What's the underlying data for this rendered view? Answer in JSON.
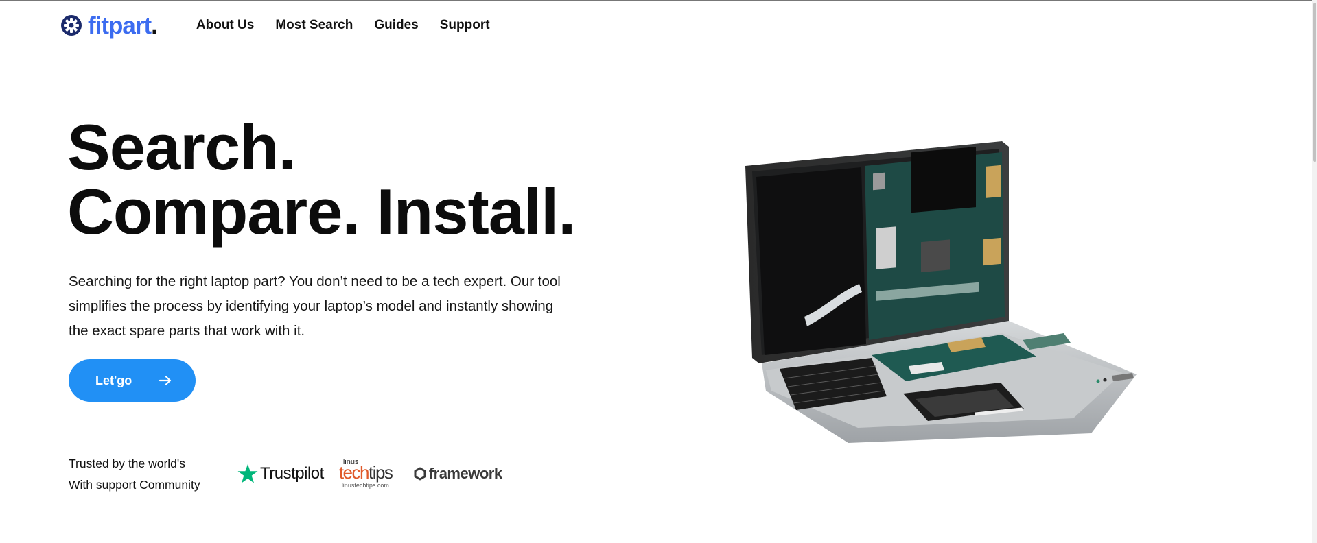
{
  "brand": {
    "name": "fitpart",
    "dot": ".",
    "icon": "gear-icon",
    "color": "#3c6cf0"
  },
  "nav": {
    "items": [
      "About Us",
      "Most Search",
      "Guides",
      "Support"
    ]
  },
  "hero": {
    "title_line1": "Search.",
    "title_line2": "Compare. Install.",
    "description": "Searching for the right laptop part? You don’t need to be a tech expert. Our tool simplifies the process by identifying your laptop’s model and instantly showing the exact spare parts that work with it.",
    "cta_label": "Let'go",
    "cta_icon": "arrow-right-icon",
    "cta_color": "#2190f5"
  },
  "trusted": {
    "line1": "Trusted by the world's",
    "line2": "With support Community",
    "logos": {
      "trustpilot": {
        "name": "Trustpilot",
        "icon": "star-icon",
        "color": "#00b67a"
      },
      "linustechtips": {
        "top": "linus",
        "tech": "tech",
        "tips": "tips",
        "url": "linustechtips.com"
      },
      "framework": {
        "name": "framework",
        "icon": "framework-gear-icon"
      }
    }
  },
  "hero_image": {
    "icon": "laptop-illustration"
  }
}
